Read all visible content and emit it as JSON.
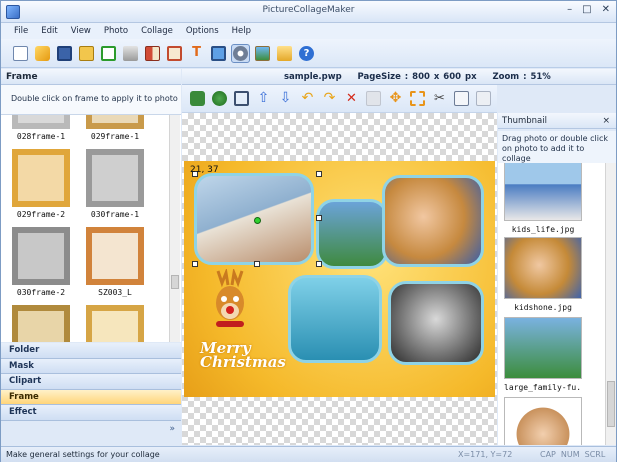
{
  "window": {
    "title": "PictureCollageMaker"
  },
  "menu": [
    "File",
    "Edit",
    "View",
    "Photo",
    "Collage",
    "Options",
    "Help"
  ],
  "toolbar": {
    "buttons": [
      "new-icon",
      "open-icon",
      "save-icon",
      "book-icon",
      "checkbox-icon",
      "print-icon",
      "layout-icon",
      "grid-icon",
      "text-icon",
      "monitor-icon",
      "settings-icon",
      "picture-icon",
      "folder-icon",
      "help-icon"
    ],
    "active_index": 10
  },
  "left_panel": {
    "header": "Frame",
    "hint": "Double click on frame to apply it to photo",
    "frames": [
      "028frame-1",
      "029frame-1",
      "029frame-2",
      "030frame-1",
      "030frame-2",
      "SZ003_L"
    ],
    "tabs": [
      "Folder",
      "Mask",
      "Clipart",
      "Frame",
      "Effect"
    ],
    "active_tab": "Frame",
    "more": "»"
  },
  "document": {
    "filename": "sample.pwp",
    "page_size": "PageSize : 800 x 600 px",
    "zoom": "Zoom : 51%"
  },
  "edit_toolbar": [
    "add-photo-icon",
    "tree-icon",
    "crop-icon",
    "bring-forward-icon",
    "send-backward-icon",
    "undo-icon",
    "redo-icon",
    "delete-icon",
    "disabled-icon",
    "move-icon",
    "resize-icon",
    "scissors-icon",
    "copy-icon",
    "paste-icon"
  ],
  "canvas": {
    "coord_readout": "21, 37",
    "greeting_line1": "Merry",
    "greeting_line2": "Christmas"
  },
  "thumbnail_panel": {
    "header": "Thumbnail",
    "close": "×",
    "hint": "Drag photo or double click on photo to add it to collage",
    "items": [
      "kids_life.jpg",
      "kidshone.jpg",
      "large_family-fu..."
    ]
  },
  "status": {
    "message": "Make general settings for your collage",
    "coords": "X=171, Y=72",
    "cap": "CAP",
    "num": "NUM",
    "scrl": "SCRL"
  },
  "colors": {
    "accent": "#ffd57a",
    "chrome": "#dae6f6",
    "collage_background": "#f5b92a",
    "photo_border": "#8fd3e6"
  }
}
